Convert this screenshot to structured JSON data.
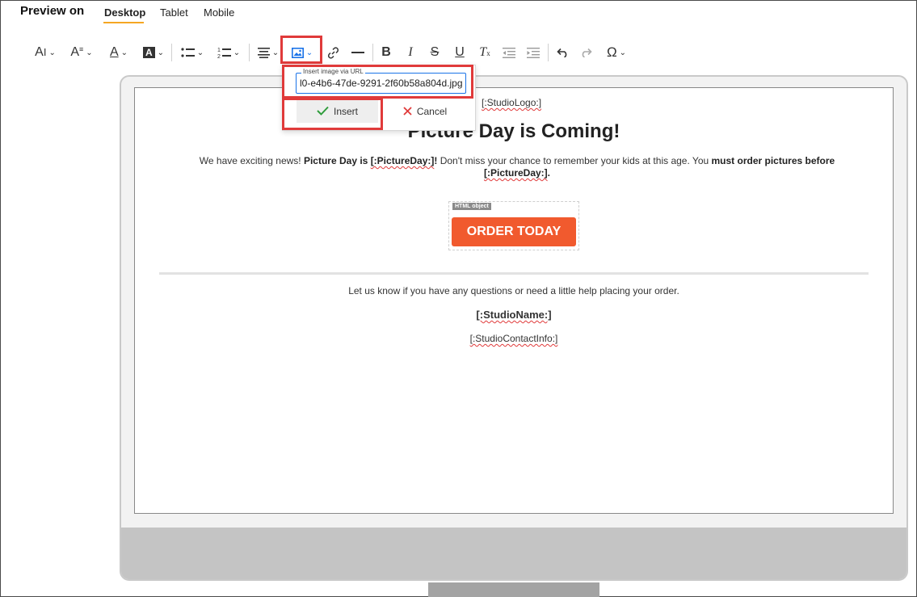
{
  "preview": {
    "label": "Preview on",
    "tabs": [
      "Desktop",
      "Tablet",
      "Mobile"
    ],
    "active_tab": "Desktop"
  },
  "toolbar": {
    "items": [
      "font-size",
      "paragraph-format",
      "text-color",
      "background-color",
      "bulleted-list",
      "numbered-list",
      "align",
      "insert-image",
      "insert-link",
      "horizontal-line",
      "bold",
      "italic",
      "strikethrough",
      "underline",
      "clear-formatting",
      "outdent",
      "indent",
      "undo",
      "redo",
      "special-characters"
    ]
  },
  "image_popup": {
    "legend": "Insert image via URL",
    "url_value": "l0-e4b6-47de-9291-2f60b58a804d.jpg",
    "insert_label": "Insert",
    "cancel_label": "Cancel"
  },
  "email": {
    "logo_placeholder": "[:StudioLogo:]",
    "headline": "Picture Day is Coming!",
    "para_1": "We have exciting news! ",
    "para_2": "Picture Day is ",
    "para_3": "[:PictureDay:]",
    "para_4": "!",
    "para_5": " Don't miss your chance to remember your kids at this age. You ",
    "para_6": "must order pictures before ",
    "para_7": "[:PictureDay:]",
    "para_8": ".",
    "html_object_label": "HTML object",
    "order_button": "ORDER TODAY",
    "help_text": "Let us know if you have any questions or need a little help placing your order.",
    "studio_name": "[:StudioName:]",
    "studio_contact": "[:StudioContactInfo:]"
  },
  "colors": {
    "accent_underline": "#f5a623",
    "highlight_box": "#e03a3a",
    "order_button": "#f15a2e",
    "image_icon": "#1a73e8"
  }
}
